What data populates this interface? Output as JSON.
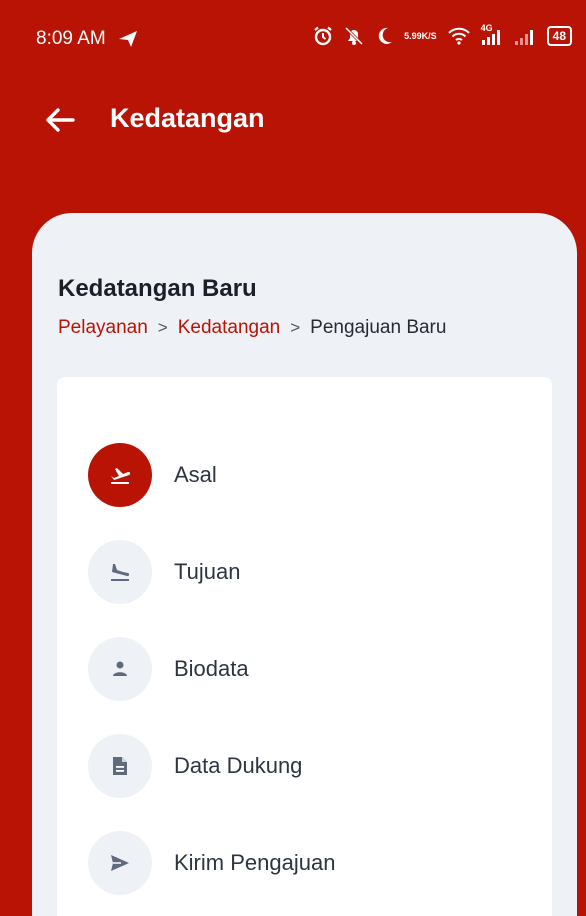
{
  "status_bar": {
    "time": "8:09 AM",
    "net_speed_value": "5.99",
    "net_speed_unit": "K/S",
    "network_type": "4G",
    "battery": "48"
  },
  "app_bar": {
    "title": "Kedatangan",
    "back_icon": "arrow-left-icon"
  },
  "content": {
    "section_title": "Kedatangan Baru",
    "breadcrumb": [
      {
        "label": "Pelayanan"
      },
      {
        "label": "Kedatangan"
      },
      {
        "label": "Pengajuan Baru"
      }
    ],
    "breadcrumb_separator": ">",
    "steps": [
      {
        "label": "Asal",
        "icon": "flight-takeoff-icon",
        "active": true
      },
      {
        "label": "Tujuan",
        "icon": "flight-land-icon",
        "active": false
      },
      {
        "label": "Biodata",
        "icon": "person-icon",
        "active": false
      },
      {
        "label": "Data Dukung",
        "icon": "document-icon",
        "active": false
      },
      {
        "label": "Kirim Pengajuan",
        "icon": "send-icon",
        "active": false
      }
    ]
  },
  "colors": {
    "primary": "#b91306",
    "background": "#eef1f6",
    "card": "#ffffff",
    "inactive_icon": "#5f6b7d"
  }
}
